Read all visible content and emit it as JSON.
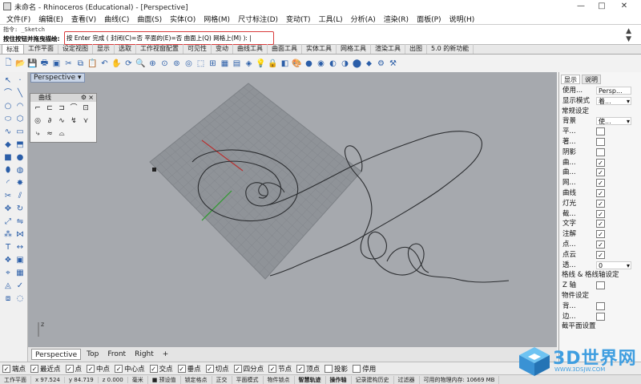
{
  "window": {
    "title": "未命名 - Rhinoceros (Educational) - [Perspective]",
    "min": "—",
    "max": "□",
    "close": "✕"
  },
  "menu": [
    "文件(F)",
    "编辑(E)",
    "查看(V)",
    "曲线(C)",
    "曲面(S)",
    "实体(O)",
    "网格(M)",
    "尺寸标注(D)",
    "变动(T)",
    "工具(L)",
    "分析(A)",
    "渲染(R)",
    "面板(P)",
    "说明(H)"
  ],
  "command": {
    "history": "指令: _Sketch",
    "prompt": "按住按钮并拖曳描绘:",
    "options": "按 Enter 完成 ( 封闭(C)=否  平面的(E)=否  曲面上(Q)   网格上(M) ): |"
  },
  "tabs": [
    "标准",
    "工作平面",
    "设定视图",
    "显示",
    "选取",
    "工作视窗配置",
    "可见性",
    "变动",
    "曲线工具",
    "曲面工具",
    "实体工具",
    "网格工具",
    "渲染工具",
    "出图",
    "5.0 的新功能"
  ],
  "viewport": {
    "label": "Perspective",
    "bg_color": "#a6a9ae",
    "axis_label": "z"
  },
  "curve_panel": {
    "title": "曲线"
  },
  "view_tabs": [
    "Perspective",
    "Top",
    "Front",
    "Right",
    "+"
  ],
  "right_panel": {
    "tabs": [
      "显示",
      "说明"
    ],
    "rows": [
      {
        "label": "使用...",
        "value": "Persp..."
      },
      {
        "label": "显示模式",
        "value": "着...",
        "dropdown": true
      },
      {
        "label": "常规设定",
        "section": true
      },
      {
        "label": "背景",
        "value": "使...",
        "dropdown": true
      },
      {
        "label": "平...",
        "check": false
      },
      {
        "label": "著...",
        "check": false
      },
      {
        "label": "阴影",
        "check": false
      },
      {
        "label": "曲...",
        "check": true
      },
      {
        "label": "曲...",
        "check": true
      },
      {
        "label": "网...",
        "check": true
      },
      {
        "label": "曲线",
        "check": true
      },
      {
        "label": "灯光",
        "check": true
      },
      {
        "label": "截...",
        "check": true
      },
      {
        "label": "文字",
        "check": true
      },
      {
        "label": "注解",
        "check": true
      },
      {
        "label": "点...",
        "check": true
      },
      {
        "label": "点云",
        "check": true
      },
      {
        "label": "透...",
        "value": "0",
        "dropdown": true
      },
      {
        "label": "格线 & 格线轴设定",
        "section": true
      },
      {
        "label": "Z 轴",
        "check": false
      },
      {
        "label": "物件设定",
        "section": true
      },
      {
        "label": "背...",
        "check": false
      },
      {
        "label": "边...",
        "check": false
      },
      {
        "label": "截平面设置",
        "section": true
      }
    ]
  },
  "snaps": [
    {
      "label": "端点",
      "on": true
    },
    {
      "label": "最近点",
      "on": true
    },
    {
      "label": "点",
      "on": true
    },
    {
      "label": "中点",
      "on": true
    },
    {
      "label": "中心点",
      "on": true
    },
    {
      "label": "交点",
      "on": true
    },
    {
      "label": "垂点",
      "on": true
    },
    {
      "label": "切点",
      "on": true
    },
    {
      "label": "四分点",
      "on": true
    },
    {
      "label": "节点",
      "on": true
    },
    {
      "label": "顶点",
      "on": true
    },
    {
      "label": "投影",
      "on": false
    },
    {
      "label": "停用",
      "on": false
    }
  ],
  "status": [
    "工作平面",
    "x 97.524",
    "y 84.719",
    "z 0.000",
    "毫米",
    "■ 预设值",
    "锁定格点",
    "正交",
    "平面模式",
    "物件锁点",
    "智慧轨迹",
    "操作轴",
    "记录建构历史",
    "过滤器",
    "可用的物理内存: 10669 MB"
  ],
  "watermark": {
    "text": "3D世界网",
    "url": "WWW.3DSJW.COM"
  }
}
